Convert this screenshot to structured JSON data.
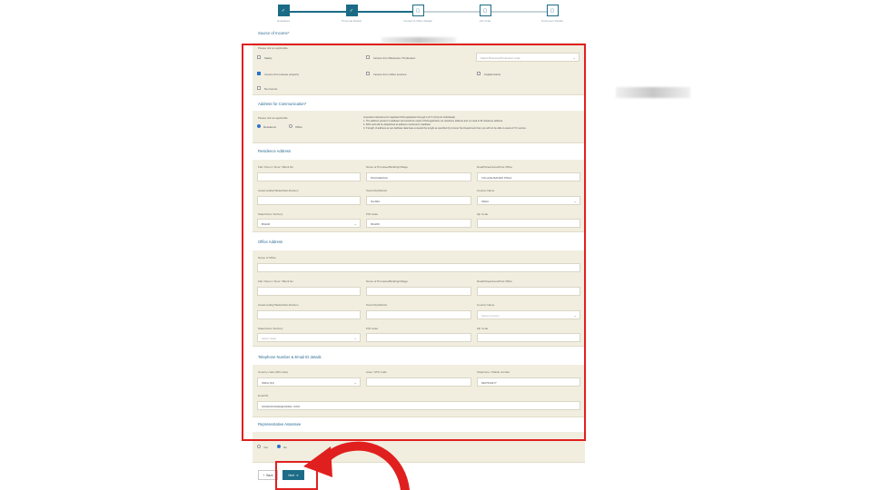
{
  "stepper": {
    "steps": [
      {
        "label": "Guidelines",
        "icon": "check-icon",
        "state": "done"
      },
      {
        "label": "Personal Details",
        "icon": "check-icon",
        "state": "done"
      },
      {
        "label": "Contact & Other Details",
        "icon": "document-icon",
        "state": "current"
      },
      {
        "label": "AO Code",
        "icon": "document-icon",
        "state": "pending"
      },
      {
        "label": "Document Details",
        "icon": "document-icon",
        "state": "pending"
      }
    ]
  },
  "source_of_income": {
    "title": "Source of Income*",
    "prompt": "Please tick as applicable",
    "options": [
      {
        "label": "Salary",
        "checked": false
      },
      {
        "label": "Income from Business / Profession",
        "checked": false
      },
      {
        "label": "Income from House property",
        "checked": true
      },
      {
        "label": "Income from Other sources",
        "checked": false
      },
      {
        "label": "Capital Gains",
        "checked": false
      },
      {
        "label": "No income",
        "checked": false
      }
    ],
    "business_select_placeholder": "Select Business/Profession code"
  },
  "communication": {
    "title": "Address for Communication*",
    "prompt": "Please tick as applicable",
    "options": [
      {
        "label": "Residence",
        "selected": true
      },
      {
        "label": "Office",
        "selected": false
      }
    ],
    "notes": [
      "Important instructions for Applicant PAN application through e-KYC (Only for individuals)",
      "1. The address present in Aadhaar card would be used in PAN application as residence address and no need to fill residence address.",
      "2. PAN card will be dispatched at address mentioned in Aadhaar.",
      "3. If length of address as per Aadhaar data base exceeds the length as specified by Income Tax Department then you will not be able to avail e-KYC service."
    ]
  },
  "residence": {
    "title": "Residence Address",
    "labels": {
      "flat": "Flat / Room / Door / Block No",
      "premises": "Name of Premises/Building/Village",
      "road": "Road/Street/Lane/Post Office",
      "area": "Area/Locality/Taluka/Sub-Division",
      "town": "Town/City/District",
      "country": "Country Name",
      "state": "State/Union Territory",
      "pin": "PIN Code",
      "zip": "Zip Code"
    },
    "values": {
      "flat": "",
      "premises": "PAUCHENGA",
      "road": "VILLAGE BANAM POHA",
      "area": "",
      "town": "NAJMA",
      "country": "INDIA",
      "state": "BIHAR",
      "pin": "811206",
      "zip": ""
    }
  },
  "office": {
    "title": "Office Address",
    "labels": {
      "name": "Name of Office",
      "flat": "Flat / Room / Door / Block No",
      "premises": "Name of Premises/Building/Village",
      "road": "Road/Street/Lane/Post Office",
      "area": "Area/Locality/Taluka/Sub-Division",
      "town": "Town/City/District",
      "country": "Country Name",
      "state": "State/Union Territory",
      "pin": "PIN Code",
      "zip": "Zip Code"
    },
    "placeholders": {
      "country": "Select Country",
      "state": "Select State"
    }
  },
  "telephone": {
    "title": "Telephone Number & Email ID details",
    "labels": {
      "country_code": "Country code (ISD code)",
      "std": "Area / STD Code",
      "mobile": "Telephone / Mobile number",
      "email": "Email ID"
    },
    "values": {
      "country_code": "INDIA (91)",
      "std": "",
      "mobile": "9407634477",
      "email": "SUMANKUMAR@GMAIL.COM"
    }
  },
  "representative": {
    "title": "Representative Assessee",
    "options": [
      {
        "label": "Yes",
        "selected": false
      },
      {
        "label": "No",
        "selected": true
      }
    ]
  },
  "actions": {
    "back_label": "Back",
    "next_label": "Next"
  },
  "colors": {
    "accent": "#1d6c87",
    "panel": "#f1eee0",
    "highlight": "#e0201f"
  }
}
